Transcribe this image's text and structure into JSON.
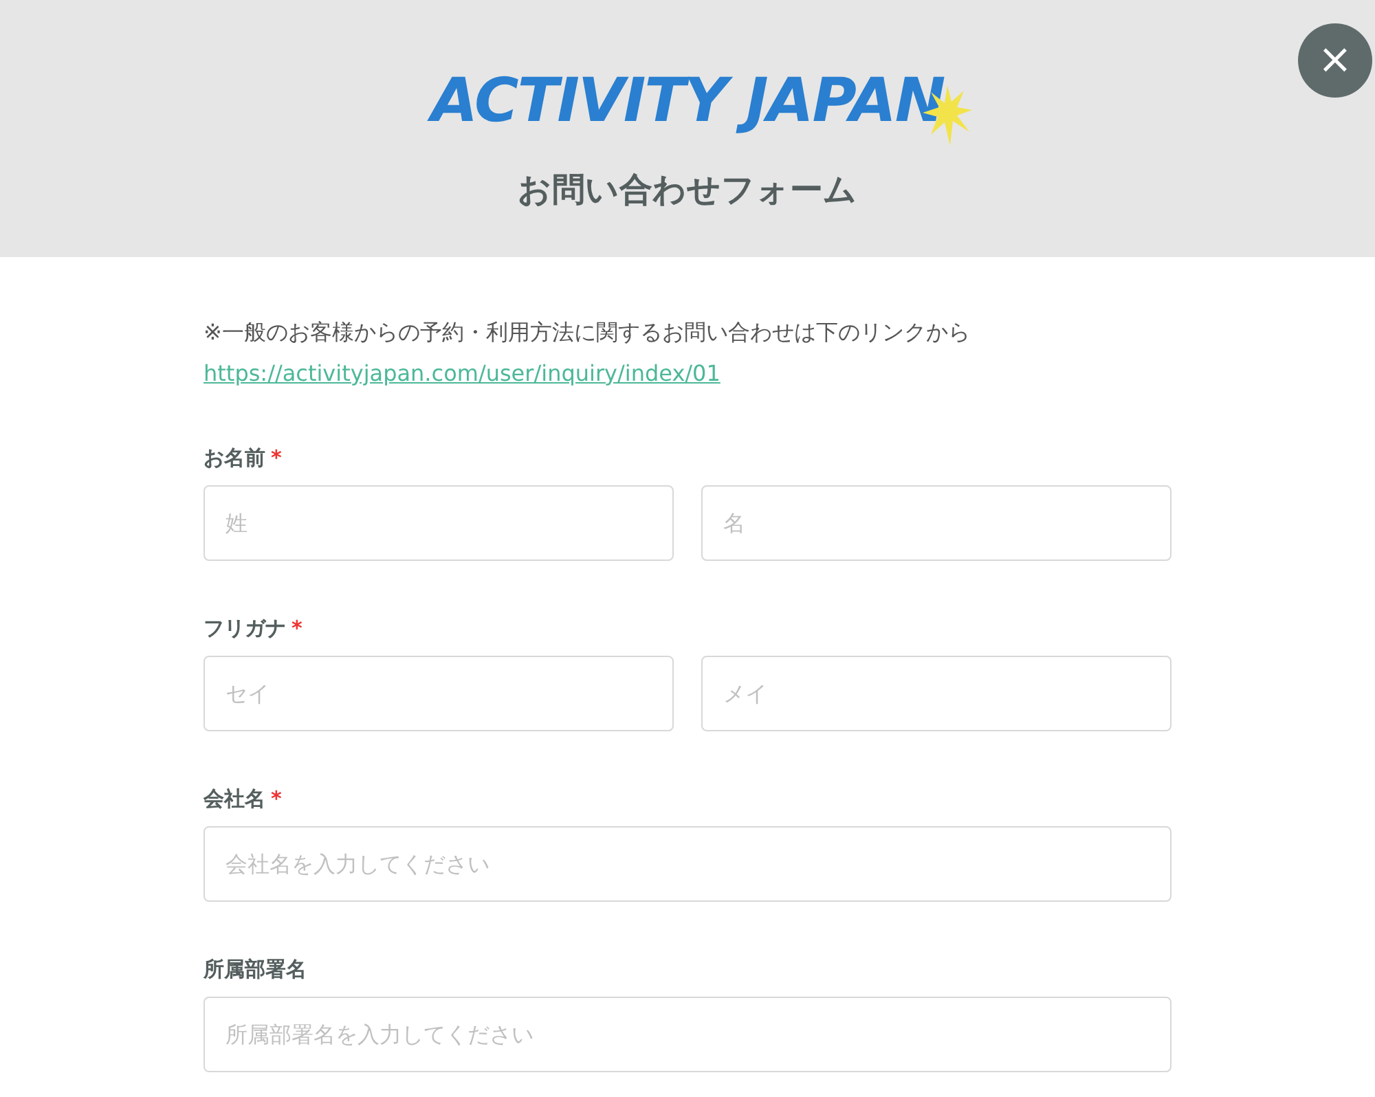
{
  "header": {
    "logo": "ACTIVITY JAPAN",
    "title": "お問い合わせフォーム",
    "close_button": "×"
  },
  "notice": {
    "text": "※一般のお客様からの予約・利用方法に関するお問い合わせは下のリンクから",
    "link": "https://activityjapan.com/user/inquiry/index/01"
  },
  "fields": [
    {
      "label": "お名前",
      "required": true,
      "inputs": [
        {
          "placeholder": "姓"
        },
        {
          "placeholder": "名"
        }
      ]
    },
    {
      "label": "フリガナ",
      "required": true,
      "inputs": [
        {
          "placeholder": "セイ"
        },
        {
          "placeholder": "メイ"
        }
      ]
    },
    {
      "label": "会社名",
      "required": true,
      "inputs": [
        {
          "placeholder": "会社名を入力してください"
        }
      ]
    },
    {
      "label": "所属部署名",
      "required": false,
      "inputs": [
        {
          "placeholder": "所属部署名を入力してください"
        }
      ]
    }
  ],
  "required_mark": "*"
}
